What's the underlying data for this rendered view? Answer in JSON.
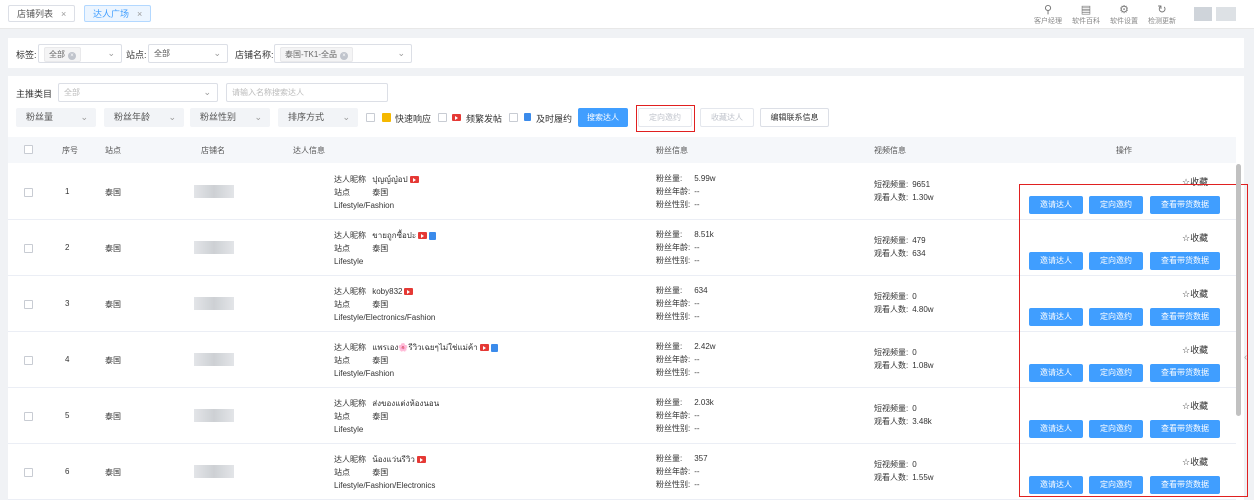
{
  "tabs": [
    {
      "label": "店铺列表",
      "close": "×"
    },
    {
      "label": "达人广场",
      "close": "×"
    }
  ],
  "toolbar": [
    {
      "icon": "person-icon",
      "glyph": "⚲",
      "label": "客户经理"
    },
    {
      "icon": "book-icon",
      "glyph": "▤",
      "label": "软件百科"
    },
    {
      "icon": "gear-icon",
      "glyph": "⚙",
      "label": "软件设置"
    },
    {
      "icon": "refresh-icon",
      "glyph": "↻",
      "label": "检测更新"
    }
  ],
  "filters": {
    "tag_label": "标签:",
    "tag_value": "全部",
    "site_label": "站点:",
    "site_value": "全部",
    "shop_label": "店铺名称:",
    "shop_value": "泰国-TK1-全品",
    "category_label": "主推类目",
    "category_placeholder": "全部",
    "search_placeholder": "请输入名称搜索达人"
  },
  "sort_selects": [
    "粉丝量",
    "粉丝年龄",
    "粉丝性别",
    "排序方式"
  ],
  "checkboxes": [
    "快速响应",
    "频繁发帖",
    "及时履约"
  ],
  "buttons": {
    "search": "搜索达人",
    "targeted_invite": "定向邀约",
    "favorite_influencer": "收藏达人",
    "edit_contact": "编辑联系信息"
  },
  "table": {
    "headers": {
      "index": "序号",
      "site": "站点",
      "shop": "店铺名",
      "influencer": "达人信息",
      "fans": "粉丝信息",
      "video": "视频信息",
      "actions": "操作"
    },
    "labels": {
      "nickname": "达人昵称",
      "site": "站点",
      "fans_count": "粉丝量:",
      "fans_age": "粉丝年龄:",
      "fans_gender": "粉丝性别:",
      "video_count": "短视频量:",
      "viewers": "观看人数:",
      "favorite": "☆收藏",
      "invite": "邀请达人",
      "targeted": "定向邀约",
      "view_data": "查看带货数据"
    },
    "rows": [
      {
        "index": "1",
        "site": "泰国",
        "nickname": "ปุญญ์ญ๋อป",
        "badges": [
          "yt"
        ],
        "category": "Lifestyle/Fashion",
        "fans": "5.99w",
        "age": "--",
        "gender": "--",
        "videos": "9651",
        "viewers": "1.30w"
      },
      {
        "index": "2",
        "site": "泰国",
        "nickname": "ขายถูกซื้อปะ",
        "badges": [
          "yt",
          "doc"
        ],
        "category": "Lifestyle",
        "fans": "8.51k",
        "age": "--",
        "gender": "--",
        "videos": "479",
        "viewers": "634"
      },
      {
        "index": "3",
        "site": "泰国",
        "nickname": "koby832",
        "badges": [
          "yt"
        ],
        "category": "Lifestyle/Electronics/Fashion",
        "fans": "634",
        "age": "--",
        "gender": "--",
        "videos": "0",
        "viewers": "4.80w"
      },
      {
        "index": "4",
        "site": "泰国",
        "nickname": "แพรเอง🌸รีวิวเฉยๆไม่ใช่แม่ค้า",
        "badges": [
          "yt",
          "doc"
        ],
        "category": "Lifestyle/Fashion",
        "fans": "2.42w",
        "age": "--",
        "gender": "--",
        "videos": "0",
        "viewers": "1.08w"
      },
      {
        "index": "5",
        "site": "泰国",
        "nickname": "ส่งของแต่งห้องนอน",
        "badges": [],
        "category": "Lifestyle",
        "fans": "2.03k",
        "age": "--",
        "gender": "--",
        "videos": "0",
        "viewers": "3.48k"
      },
      {
        "index": "6",
        "site": "泰国",
        "nickname": "น้องแว่นรีวิว",
        "badges": [
          "yt"
        ],
        "category": "Lifestyle/Fashion/Electronics",
        "fans": "357",
        "age": "--",
        "gender": "--",
        "videos": "0",
        "viewers": "1.55w"
      }
    ]
  }
}
